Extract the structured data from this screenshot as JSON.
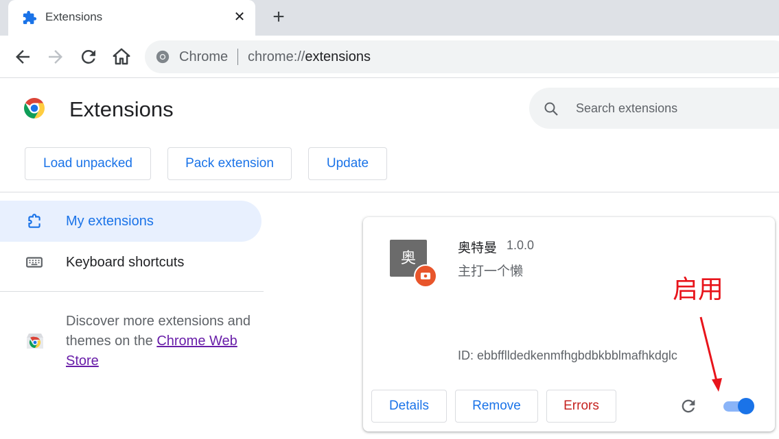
{
  "tab": {
    "title": "Extensions",
    "close_label": "✕",
    "new_tab_label": "+"
  },
  "omnibox": {
    "site_label": "Chrome",
    "url_scheme": "chrome://",
    "url_path": "extensions"
  },
  "header": {
    "title": "Extensions",
    "search_placeholder": "Search extensions"
  },
  "toolbar": {
    "load_unpacked": "Load unpacked",
    "pack_extension": "Pack extension",
    "update": "Update"
  },
  "sidebar": {
    "items": [
      {
        "label": "My extensions",
        "icon": "puzzle-icon",
        "active": true
      },
      {
        "label": "Keyboard shortcuts",
        "icon": "keyboard-icon",
        "active": false
      }
    ],
    "discover_prefix": "Discover more extensions and themes on the ",
    "discover_link": "Chrome Web Store"
  },
  "extension": {
    "icon_letter": "奥",
    "name": "奥特曼",
    "version": "1.0.0",
    "description": "主打一个懒",
    "id_text": "ID: ebbfflldedkenmfhgbdbkbblmafhkdglc",
    "details_label": "Details",
    "remove_label": "Remove",
    "errors_label": "Errors",
    "enabled": true
  },
  "annotation": {
    "text": "启用",
    "color": "#e8141b"
  },
  "colors": {
    "accent": "#1a73e8",
    "error": "#c5221f",
    "link_visited": "#681da8"
  }
}
